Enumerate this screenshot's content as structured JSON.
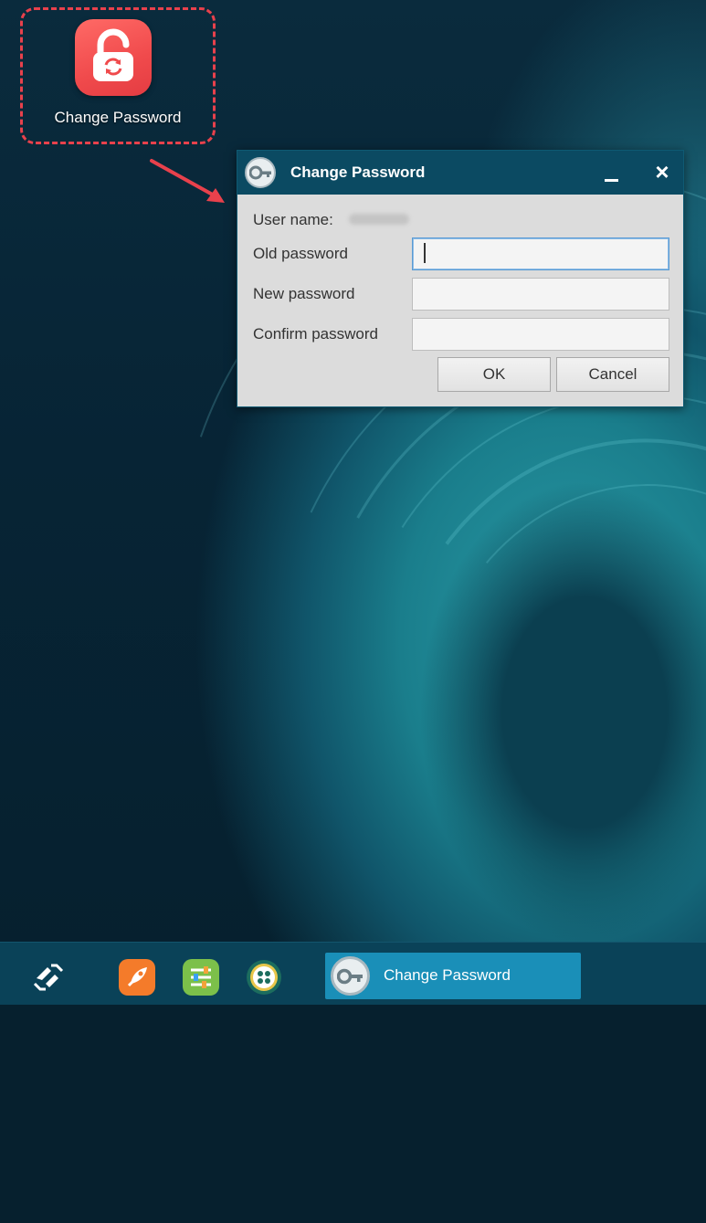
{
  "desktop": {
    "icon_label": "Change Password"
  },
  "dialog": {
    "title": "Change Password",
    "fields": {
      "username_label": "User name:",
      "old_password_label": "Old password",
      "new_password_label": "New password",
      "confirm_password_label": "Confirm password"
    },
    "buttons": {
      "ok_label": "OK",
      "cancel_label": "Cancel"
    },
    "title_icon": "key-icon"
  },
  "taskbar": {
    "items": [
      {
        "name": "launcher",
        "icon": "launcher-logo-icon"
      },
      {
        "name": "rocket-app",
        "icon": "rocket-icon"
      },
      {
        "name": "settings-app",
        "icon": "sliders-icon"
      },
      {
        "name": "apps-app",
        "icon": "apps-grid-icon"
      }
    ],
    "active_window_label": "Change Password"
  },
  "colors": {
    "accent_red": "#e8414c",
    "titlebar": "#0b4a62",
    "taskbar": "#0a4258",
    "taskbar_active": "#1a8fb8"
  }
}
